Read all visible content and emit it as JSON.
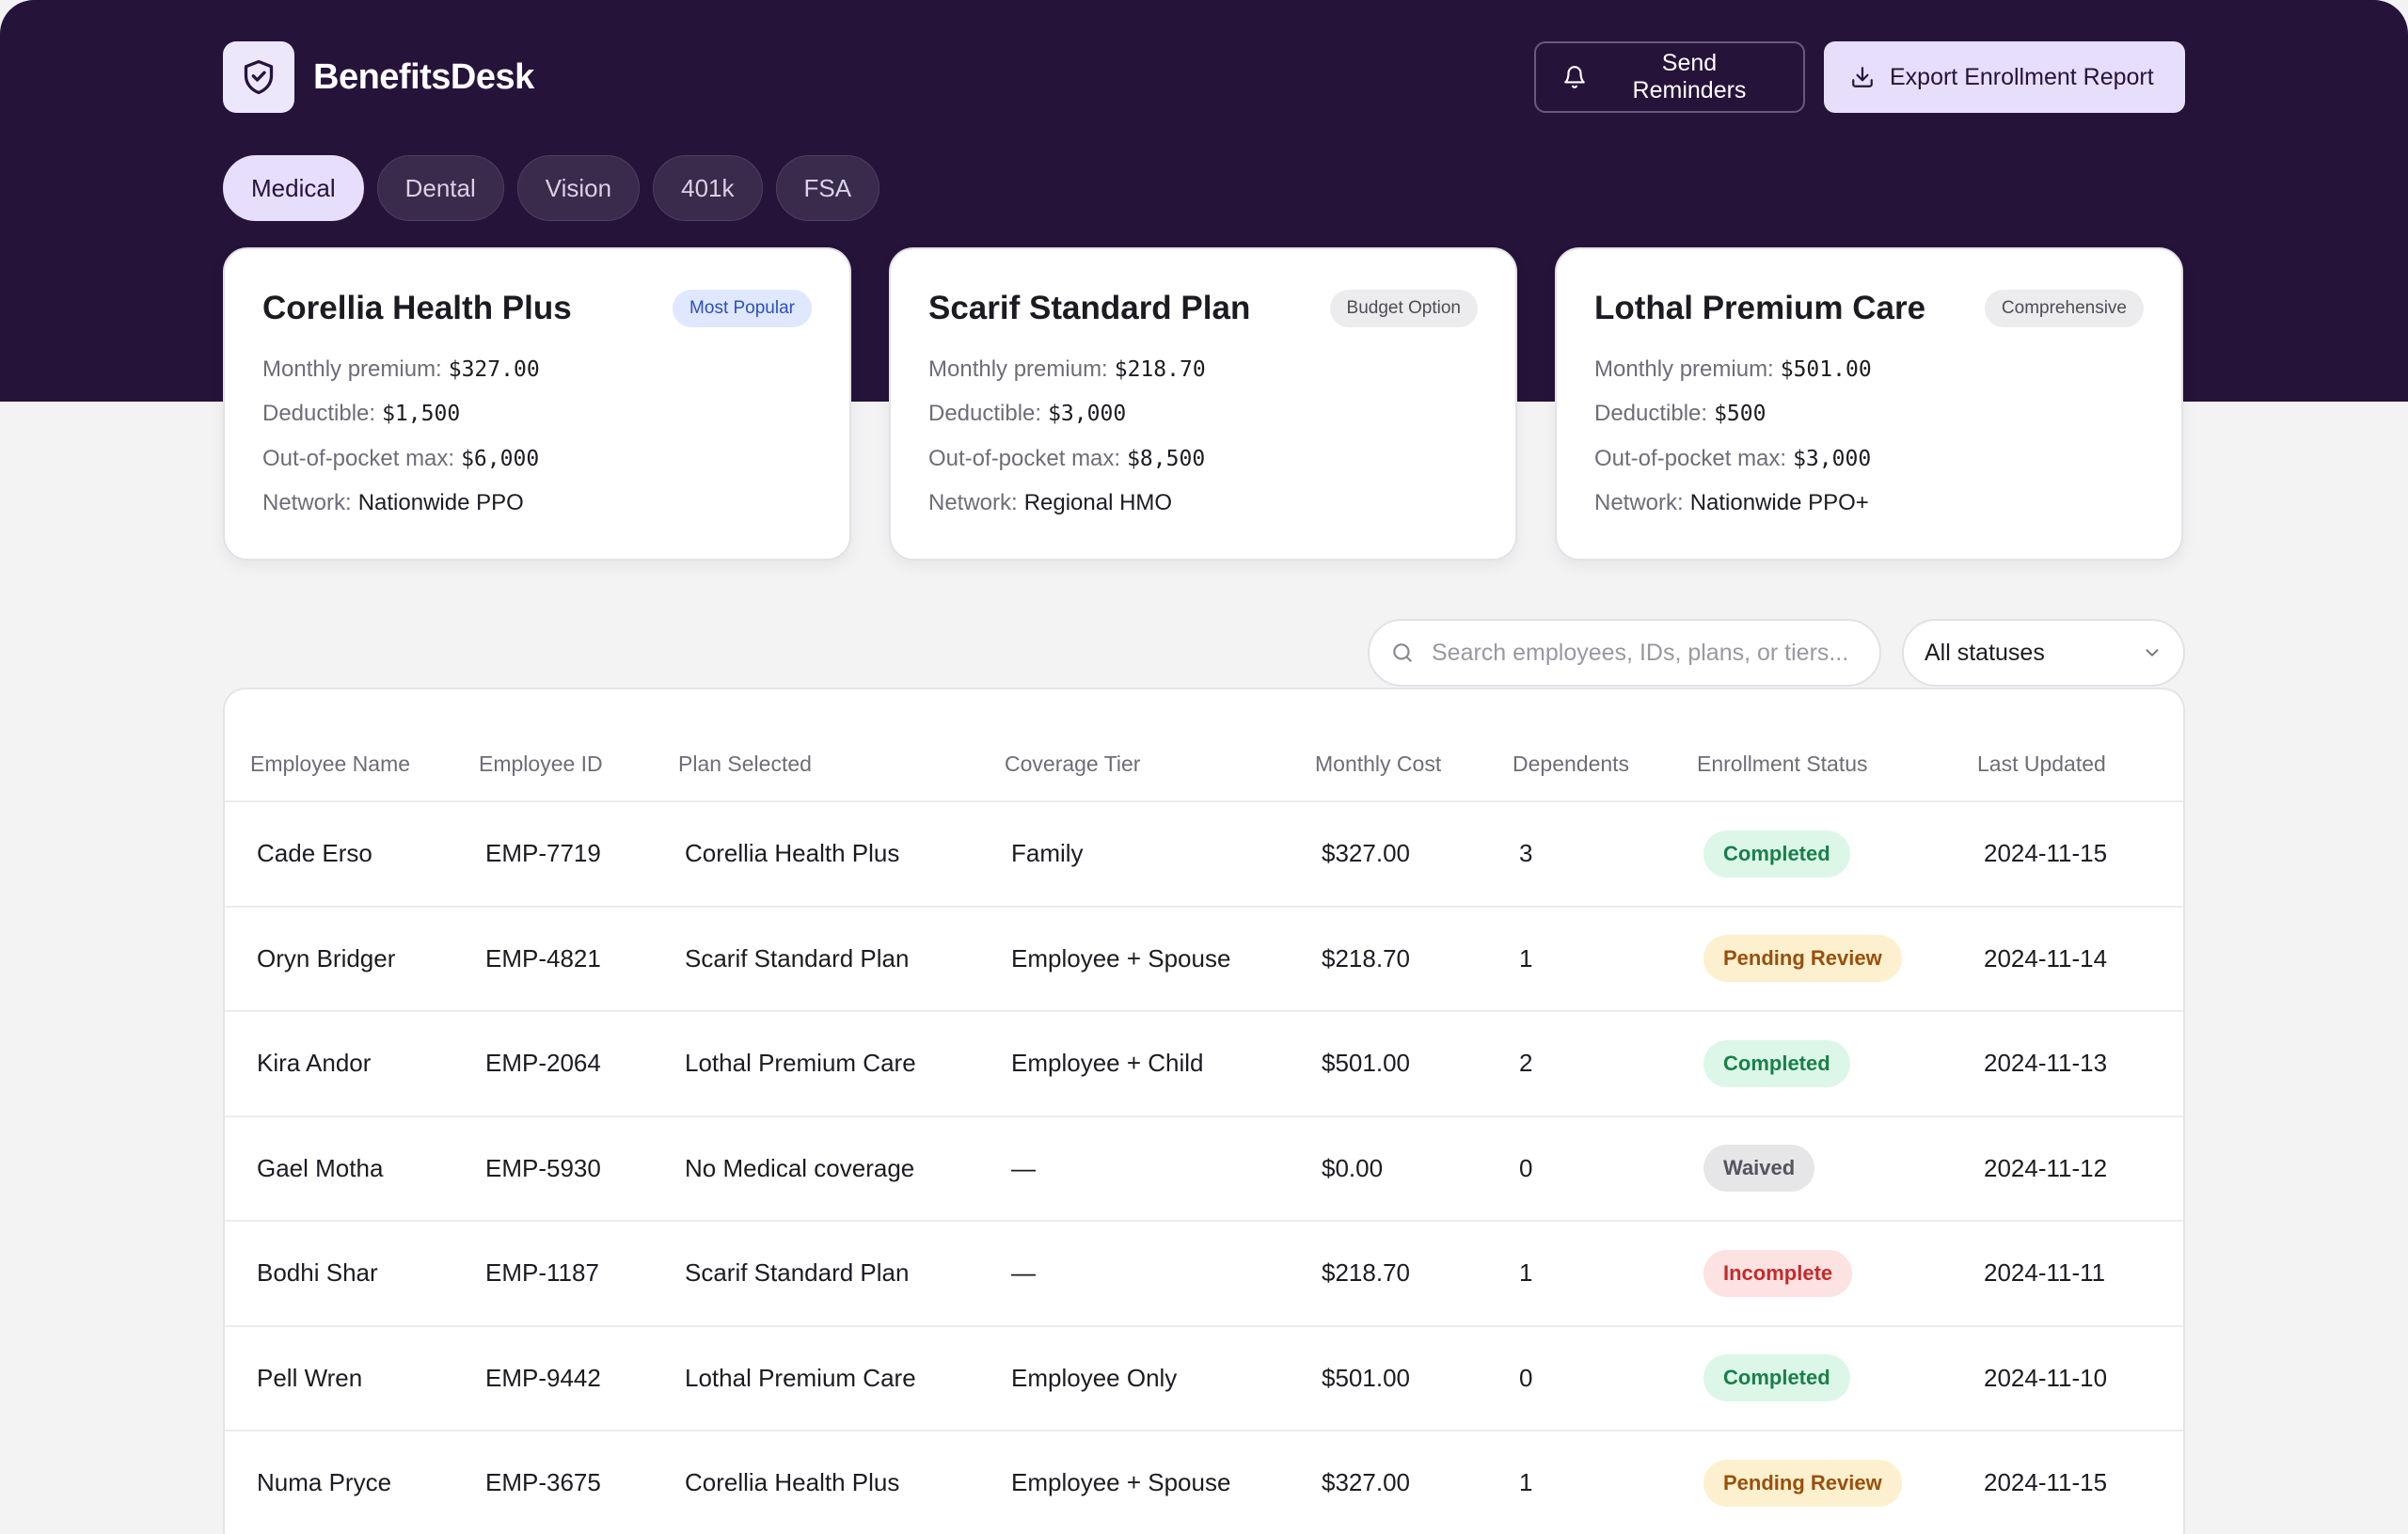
{
  "app": {
    "name": "BenefitsDesk"
  },
  "header": {
    "send_reminders_label": "Send Reminders",
    "export_label": "Export Enrollment Report"
  },
  "tabs": [
    {
      "label": "Medical",
      "active": true
    },
    {
      "label": "Dental",
      "active": false
    },
    {
      "label": "Vision",
      "active": false
    },
    {
      "label": "401k",
      "active": false
    },
    {
      "label": "FSA",
      "active": false
    }
  ],
  "labels": {
    "premium": "Monthly premium:",
    "deductible": "Deductible:",
    "oop": "Out-of-pocket max:",
    "network": "Network:"
  },
  "plans": [
    {
      "name": "Corellia Health Plus",
      "badge": "Most Popular",
      "premium": "$327.00",
      "deductible": "$1,500",
      "oop": "$6,000",
      "network": "Nationwide PPO"
    },
    {
      "name": "Scarif Standard Plan",
      "badge": "Budget Option",
      "premium": "$218.70",
      "deductible": "$3,000",
      "oop": "$8,500",
      "network": "Regional HMO"
    },
    {
      "name": "Lothal Premium Care",
      "badge": "Comprehensive",
      "premium": "$501.00",
      "deductible": "$500",
      "oop": "$3,000",
      "network": "Nationwide PPO+"
    }
  ],
  "search": {
    "placeholder": "Search employees, IDs, plans, or tiers...",
    "value": ""
  },
  "status_filter": {
    "selected": "All statuses"
  },
  "table": {
    "columns": [
      "Employee Name",
      "Employee ID",
      "Plan Selected",
      "Coverage Tier",
      "Monthly Cost",
      "Dependents",
      "Enrollment Status",
      "Last Updated"
    ],
    "rows": [
      {
        "name": "Cade Erso",
        "id": "EMP-7719",
        "plan": "Corellia Health Plus",
        "tier": "Family",
        "cost": "$327.00",
        "dependents": "3",
        "status": "Completed",
        "updated": "2024-11-15"
      },
      {
        "name": "Oryn Bridger",
        "id": "EMP-4821",
        "plan": "Scarif Standard Plan",
        "tier": "Employee + Spouse",
        "cost": "$218.70",
        "dependents": "1",
        "status": "Pending Review",
        "updated": "2024-11-14"
      },
      {
        "name": "Kira Andor",
        "id": "EMP-2064",
        "plan": "Lothal Premium Care",
        "tier": "Employee + Child",
        "cost": "$501.00",
        "dependents": "2",
        "status": "Completed",
        "updated": "2024-11-13"
      },
      {
        "name": "Gael Motha",
        "id": "EMP-5930",
        "plan": "No Medical coverage",
        "tier": "—",
        "cost": "$0.00",
        "dependents": "0",
        "status": "Waived",
        "updated": "2024-11-12"
      },
      {
        "name": "Bodhi Shar",
        "id": "EMP-1187",
        "plan": "Scarif Standard Plan",
        "tier": "—",
        "cost": "$218.70",
        "dependents": "1",
        "status": "Incomplete",
        "updated": "2024-11-11"
      },
      {
        "name": "Pell Wren",
        "id": "EMP-9442",
        "plan": "Lothal Premium Care",
        "tier": "Employee Only",
        "cost": "$501.00",
        "dependents": "0",
        "status": "Completed",
        "updated": "2024-11-10"
      },
      {
        "name": "Numa Pryce",
        "id": "EMP-3675",
        "plan": "Corellia Health Plus",
        "tier": "Employee + Spouse",
        "cost": "$327.00",
        "dependents": "1",
        "status": "Pending Review",
        "updated": "2024-11-15"
      }
    ]
  },
  "colors": {
    "header_bg": "#26133a",
    "accent_lavender": "#e7defb",
    "completed": "#19804a",
    "pending": "#9a4f0a",
    "waived": "#55535c",
    "incomplete": "#c42a2a"
  }
}
